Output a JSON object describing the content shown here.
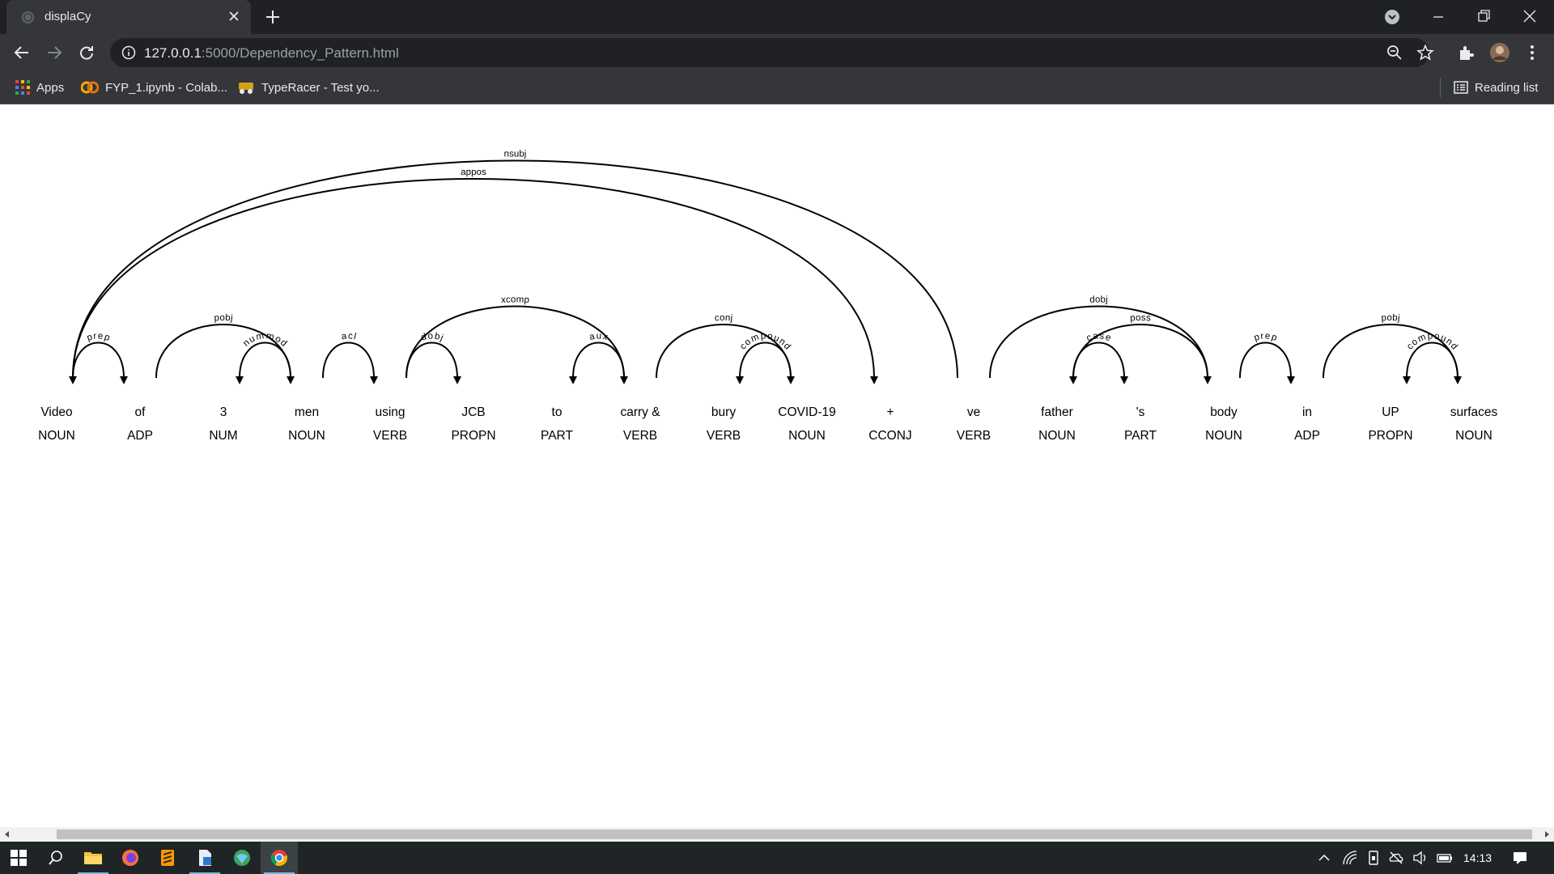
{
  "browser": {
    "tab_title": "displaCy",
    "url_host": "127.0.0.1",
    "url_rest": ":5000/Dependency_Pattern.html",
    "bookmarks": [
      "Apps",
      "FYP_1.ipynb - Colab...",
      "TypeRacer - Test yo..."
    ],
    "reading_list": "Reading list"
  },
  "parse": {
    "words": [
      {
        "text": "Video",
        "tag": "NOUN"
      },
      {
        "text": "of",
        "tag": "ADP"
      },
      {
        "text": "3",
        "tag": "NUM"
      },
      {
        "text": "men",
        "tag": "NOUN"
      },
      {
        "text": "using",
        "tag": "VERB"
      },
      {
        "text": "JCB",
        "tag": "PROPN"
      },
      {
        "text": "to",
        "tag": "PART"
      },
      {
        "text": "carry &",
        "tag": "VERB"
      },
      {
        "text": "bury",
        "tag": "VERB"
      },
      {
        "text": "COVID-19",
        "tag": "NOUN"
      },
      {
        "text": "+",
        "tag": "CCONJ"
      },
      {
        "text": "ve",
        "tag": "VERB"
      },
      {
        "text": "father",
        "tag": "NOUN"
      },
      {
        "text": "'s",
        "tag": "PART"
      },
      {
        "text": "body",
        "tag": "NOUN"
      },
      {
        "text": "in",
        "tag": "ADP"
      },
      {
        "text": "UP",
        "tag": "PROPN"
      },
      {
        "text": "surfaces",
        "tag": "NOUN"
      }
    ],
    "arcs": [
      {
        "start": 0,
        "end": 1,
        "label": "prep",
        "dir": "right"
      },
      {
        "start": 1,
        "end": 3,
        "label": "pobj",
        "dir": "right"
      },
      {
        "start": 2,
        "end": 3,
        "label": "nummod",
        "dir": "left"
      },
      {
        "start": 3,
        "end": 4,
        "label": "acl",
        "dir": "right"
      },
      {
        "start": 4,
        "end": 5,
        "label": "dobj",
        "dir": "right"
      },
      {
        "start": 4,
        "end": 7,
        "label": "xcomp",
        "dir": "right"
      },
      {
        "start": 6,
        "end": 7,
        "label": "aux",
        "dir": "left"
      },
      {
        "start": 7,
        "end": 9,
        "label": "conj",
        "dir": "right"
      },
      {
        "start": 8,
        "end": 9,
        "label": "compound",
        "dir": "left"
      },
      {
        "start": 0,
        "end": 10,
        "label": "appos",
        "dir": "right"
      },
      {
        "start": 0,
        "end": 11,
        "label": "nsubj",
        "dir": "left"
      },
      {
        "start": 11,
        "end": 14,
        "label": "dobj",
        "dir": "right"
      },
      {
        "start": 12,
        "end": 13,
        "label": "case",
        "dir": "right"
      },
      {
        "start": 12,
        "end": 14,
        "label": "poss",
        "dir": "left"
      },
      {
        "start": 14,
        "end": 15,
        "label": "prep",
        "dir": "right"
      },
      {
        "start": 15,
        "end": 17,
        "label": "pobj",
        "dir": "right"
      },
      {
        "start": 16,
        "end": 17,
        "label": "compound",
        "dir": "left"
      }
    ]
  },
  "taskbar": {
    "clock": "14:13"
  },
  "colors": {
    "titlebar": "#202124",
    "toolbar": "#35363a",
    "taskbar": "#1f2526",
    "arc": "#000000"
  }
}
